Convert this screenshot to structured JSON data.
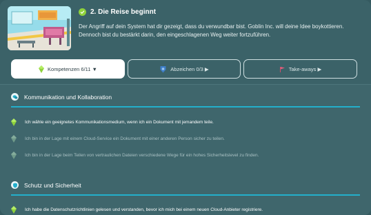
{
  "header": {
    "title": "2. Die Reise beginnt",
    "description": "Der Angriff auf dein System hat dir gezeigt, dass du verwundbar bist. Goblin Inc. will deine Idee boykottieren. Dennoch bist du bestärkt darin, den eingeschlagenen Weg weiter fortzuführen."
  },
  "tabs": [
    {
      "label": "Kompetenzen 6/11 ▼",
      "icon": "gem-icon",
      "active": true
    },
    {
      "label": "Abzeichen 0/3 ▶",
      "icon": "badge-icon",
      "active": false
    },
    {
      "label": "Take-aways ▶",
      "icon": "flag-icon",
      "active": false
    }
  ],
  "sections": [
    {
      "title": "Kommunikation und Kollaboration",
      "icon": "chat-icon",
      "items": [
        {
          "text": "Ich wähle ein geeignetes Kommunikationsmedium, wenn ich ein Dokument mit jemandem teile.",
          "done": true
        },
        {
          "text": "Ich bin in der Lage mit einem Cloud-Service ein Dokument mit einer anderen Person sicher zu teilen.",
          "done": false
        },
        {
          "text": "Ich bin in der Lage beim Teilen von vertraulichen Dateien verschiedene Wege für ein hohes Sicherheitslevel zu finden.",
          "done": false
        }
      ]
    },
    {
      "title": "Schutz und Sicherheit",
      "icon": "shield-icon",
      "items": [
        {
          "text": "Ich habe die Datenschutzrichtlinien gelesen und verstanden, bevor ich mich bei einem neuen Cloud-Anbieter registriere.",
          "done": true
        }
      ]
    }
  ],
  "colors": {
    "background": "#3b6268",
    "accent_rule": "#23b0cc",
    "gem_green": "#8fd23c",
    "check_green": "#8fd23c"
  }
}
